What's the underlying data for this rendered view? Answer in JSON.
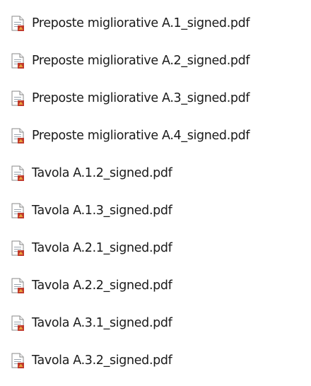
{
  "files": [
    {
      "name": "Preposte migliorative A.1_signed.pdf",
      "icon": "pdf-file-icon"
    },
    {
      "name": "Preposte migliorative A.2_signed.pdf",
      "icon": "pdf-file-icon"
    },
    {
      "name": "Preposte migliorative A.3_signed.pdf",
      "icon": "pdf-file-icon"
    },
    {
      "name": "Preposte migliorative A.4_signed.pdf",
      "icon": "pdf-file-icon"
    },
    {
      "name": "Tavola A.1.2_signed.pdf",
      "icon": "pdf-file-icon"
    },
    {
      "name": "Tavola A.1.3_signed.pdf",
      "icon": "pdf-file-icon"
    },
    {
      "name": "Tavola A.2.1_signed.pdf",
      "icon": "pdf-file-icon"
    },
    {
      "name": "Tavola A.2.2_signed.pdf",
      "icon": "pdf-file-icon"
    },
    {
      "name": "Tavola A.3.1_signed.pdf",
      "icon": "pdf-file-icon"
    },
    {
      "name": "Tavola A.3.2_signed.pdf",
      "icon": "pdf-file-icon"
    }
  ],
  "colors": {
    "icon_page": "#ffffff",
    "icon_border": "#8a8a8a",
    "icon_lines": "#9aa3ad",
    "icon_badge": "#c0392b",
    "icon_badge_accent": "#e8a33d",
    "text": "#1a1a1a"
  }
}
